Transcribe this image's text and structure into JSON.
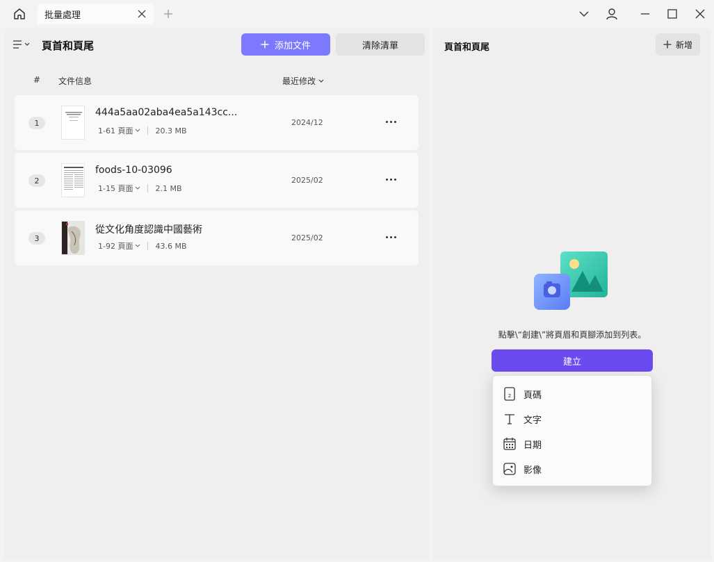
{
  "window": {
    "tab_title": "批量處理"
  },
  "left_panel": {
    "title": "頁首和頁尾",
    "add_files_label": "添加文件",
    "clear_list_label": "清除清單",
    "columns": {
      "index": "#",
      "file_info": "文件信息",
      "recent_modified": "最近修改"
    },
    "files": [
      {
        "index": "1",
        "name": "444a5aa02aba4ea5a143cc...",
        "pages": "1-61 頁面",
        "size": "20.3 MB",
        "date": "2024/12"
      },
      {
        "index": "2",
        "name": "foods-10-03096",
        "pages": "1-15 頁面",
        "size": "2.1 MB",
        "date": "2025/02"
      },
      {
        "index": "3",
        "name": "從文化角度認識中國藝術",
        "pages": "1-92 頁面",
        "size": "43.6 MB",
        "date": "2025/02"
      }
    ]
  },
  "right_panel": {
    "title": "頁首和頁尾",
    "new_label": "新增",
    "hint": "點擊\\“創建\\”將頁眉和頁腳添加到列表。",
    "create_label": "建立",
    "dropdown": [
      {
        "label": "頁碼",
        "icon": "page-number-icon"
      },
      {
        "label": "文字",
        "icon": "text-icon"
      },
      {
        "label": "日期",
        "icon": "calendar-icon"
      },
      {
        "label": "影像",
        "icon": "image-icon"
      }
    ]
  },
  "colors": {
    "add_button": "#7d79ff",
    "create_button": "#6b4bef",
    "panel_bg": "#efefef",
    "card_bg": "#f9f9f9"
  }
}
